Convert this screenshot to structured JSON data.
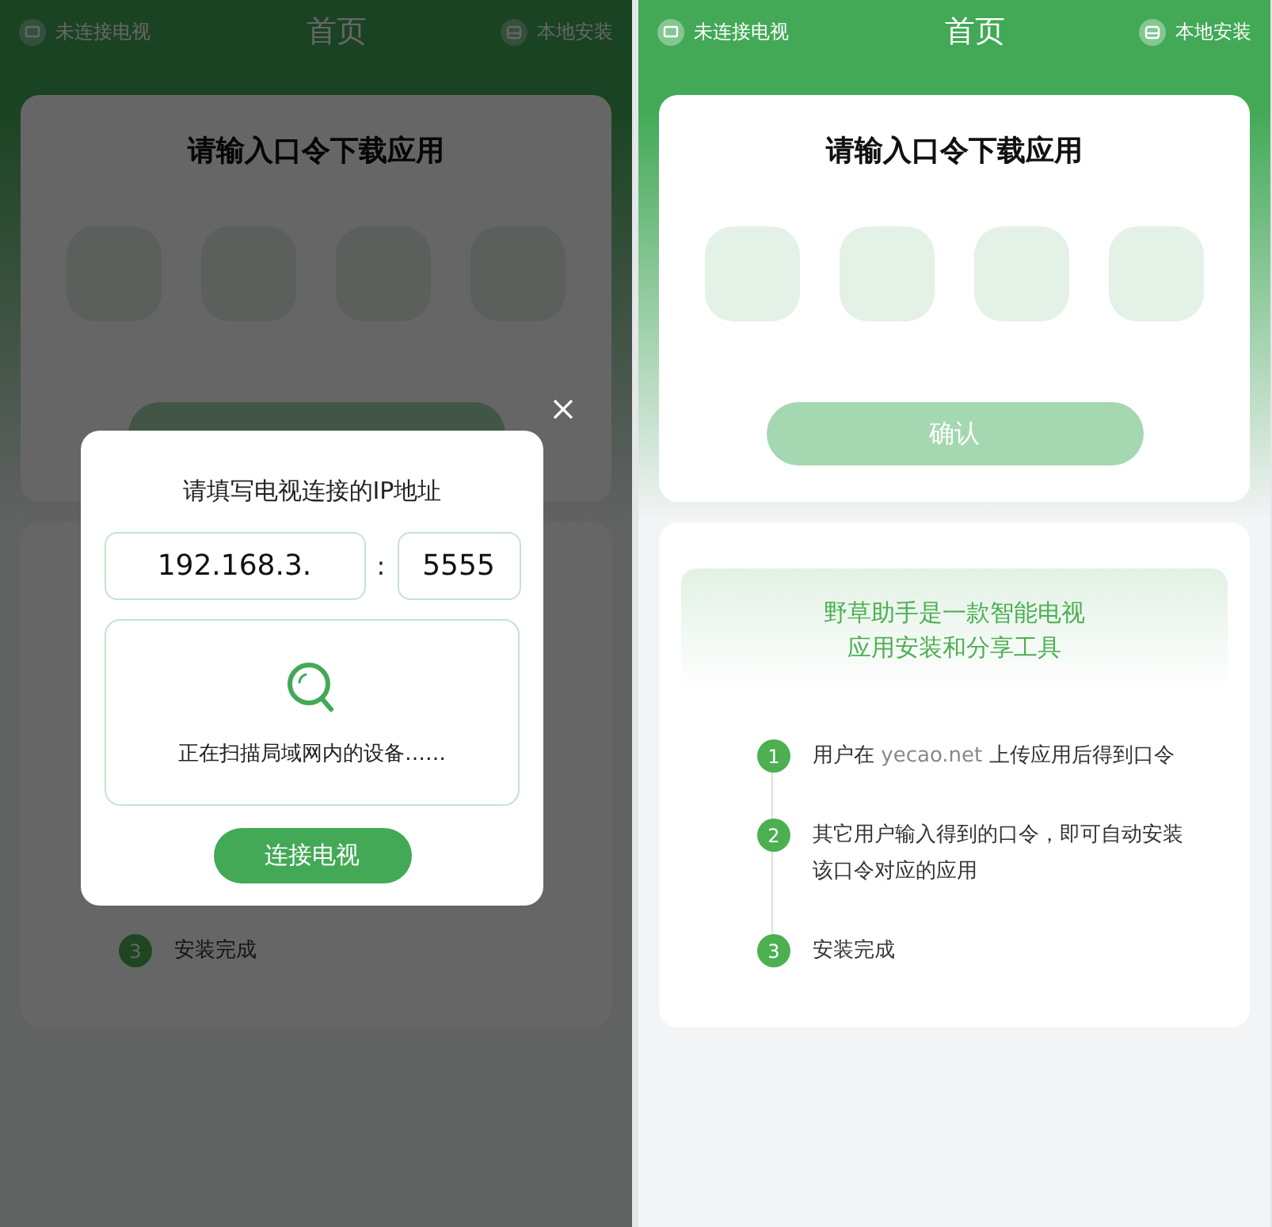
{
  "screens": [
    {
      "top_bar": {
        "left": {
          "label": "未连接电视"
        },
        "title": "首页",
        "right": {
          "label": "本地安装"
        }
      },
      "code_card": {
        "title": "请输入口令下载应用",
        "code_boxes": [
          {
            "filled": false
          },
          {
            "filled": false
          },
          {
            "filled": false
          },
          {
            "filled": false
          }
        ],
        "confirm_button": {
          "disabled": true
        }
      },
      "intro_card": {
        "steps": [
          {
            "number": "3",
            "label": "安装完成"
          }
        ]
      },
      "dialog": {
        "title": "请填写电视连接的IP地址",
        "ip_field": {
          "value": "192.168.3."
        },
        "separator": ":",
        "port_field": {
          "value": "5555"
        },
        "scan_status": "正在扫描局域网内的设备……",
        "connect_button": {
          "label": "连接电视"
        }
      }
    },
    {
      "top_bar": {
        "left": {
          "label": "未连接电视"
        },
        "title": "首页",
        "right": {
          "label": "本地安装"
        }
      },
      "code_card": {
        "title": "请输入口令下载应用",
        "code_boxes": [
          {
            "filled": false
          },
          {
            "filled": false
          },
          {
            "filled": false
          },
          {
            "filled": false
          }
        ],
        "confirm_button": {
          "label": "确认",
          "disabled": true
        }
      },
      "intro_card": {
        "banner": [
          "野草助手是一款智能电视",
          "应用安装和分享工具"
        ],
        "steps": [
          {
            "number": "1",
            "label": "用户在",
            "link": "yecao.net",
            "label_after": "上传应用后得到口令"
          },
          {
            "number": "2",
            "label": "其它用户输入得到的口令，即可自动安装该口令对应的应用"
          },
          {
            "number": "3",
            "label": "安装完成"
          }
        ]
      }
    }
  ]
}
